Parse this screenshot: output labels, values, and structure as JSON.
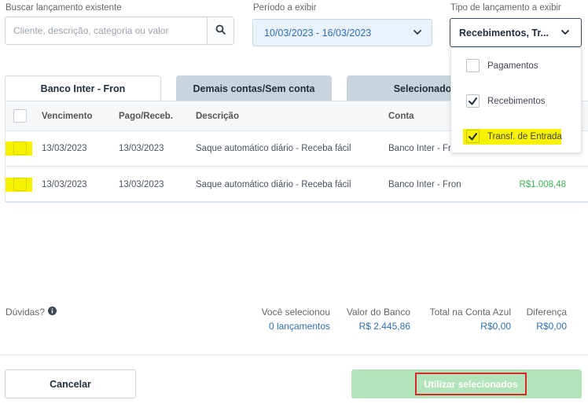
{
  "filters": {
    "search_label": "Buscar lançamento existente",
    "search_placeholder": "Cliente, descrição, categoria ou valor",
    "period_label": "Período a exibir",
    "period_value": "10/03/2023 - 16/03/2023",
    "type_label": "Tipo de lançamento a exibir",
    "type_value": "Recebimentos, Tr..."
  },
  "type_dropdown": {
    "options": [
      {
        "label": "Pagamentos",
        "checked": false
      },
      {
        "label": "Recebimentos",
        "checked": true
      },
      {
        "label": "Transf. de Entrada",
        "checked": true
      }
    ]
  },
  "tabs": [
    {
      "label": "Banco Inter - Fron",
      "active": true
    },
    {
      "label": "Demais contas/Sem conta",
      "active": false
    },
    {
      "label": "Selecionados",
      "active": false
    }
  ],
  "table": {
    "columns": [
      "Vencimento",
      "Pago/Receb.",
      "Descrição",
      "Conta"
    ],
    "rows": [
      {
        "due": "13/03/2023",
        "paid": "13/03/2023",
        "description": "Saque automático diário - Receba fácil",
        "account": "Banco Inter - Fron",
        "amount": ""
      },
      {
        "due": "13/03/2023",
        "paid": "13/03/2023",
        "description": "Saque automático diário - Receba fácil",
        "account": "Banco Inter - Fron",
        "amount": "R$1.008,48"
      }
    ]
  },
  "summary": {
    "help_label": "Dúvidas?",
    "selected_label": "Você selecionou",
    "selected_value": "0 lançamentos",
    "bank_label": "Valor do Banco",
    "bank_value": "R$ 2.445,86",
    "total_label": "Total na Conta Azul",
    "total_value": "R$0,00",
    "diff_label": "Diferença",
    "diff_value": "R$0,00"
  },
  "actions": {
    "cancel_label": "Cancelar",
    "use_label": "Utilizar selecionados"
  },
  "colors": {
    "accent_blue": "#2f6fb0",
    "positive_green": "#3cb054",
    "primary_button": "#b2e3bb",
    "highlight_yellow": "#f6f200",
    "annotation_red": "#d62828"
  }
}
